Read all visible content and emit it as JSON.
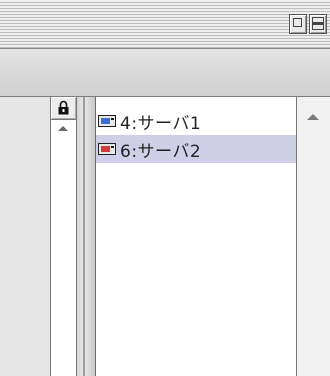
{
  "window": {
    "zoom_button": "zoom-icon",
    "collapse_button": "collapse-icon"
  },
  "left_panel": {
    "lock_icon": "lock-icon",
    "scroll_up_icon": "chevron-up-icon"
  },
  "list": {
    "items": [
      {
        "label": "4:サーバ1",
        "icon": "server-icon",
        "icon_color": "#3b6fd6",
        "selected": false
      },
      {
        "label": "6:サーバ2",
        "icon": "server-icon",
        "icon_color": "#d63b3b",
        "selected": true
      }
    ]
  },
  "right_scrollbar": {
    "scroll_up_icon": "chevron-up-icon"
  }
}
